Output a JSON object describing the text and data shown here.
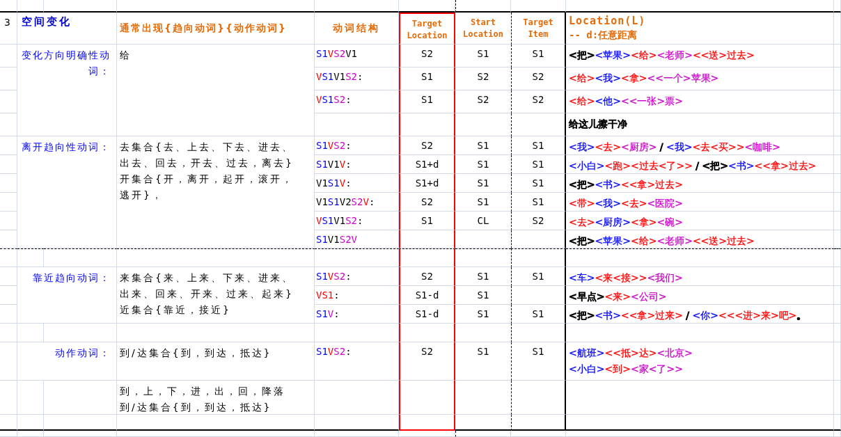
{
  "section": {
    "number": "3",
    "title": "空间变化"
  },
  "headers": {
    "usual": "通常出现{趋向动词}{动作动词}",
    "structure": "动词结构",
    "target_location": [
      "Target",
      "Location"
    ],
    "start_location": [
      "Start",
      "Location"
    ],
    "target_item": [
      "Target",
      "Item"
    ],
    "location": "Location(L)",
    "location_note": "-- d:任意距离"
  },
  "rows": [
    {
      "category": "变化方向明确性动词：",
      "verbs": [
        "给"
      ],
      "structure": [
        {
          "text": "S1",
          "color": "#0000ff"
        },
        {
          "text": "V",
          "color": "#ff0000"
        },
        {
          "text": "S2",
          "color": "#cc00cc"
        },
        {
          "text": "V1",
          "color": "#000000"
        }
      ],
      "target_location": "S2",
      "start_location": "S1",
      "target_item": "S1",
      "example": [
        [
          {
            "text": "<把>",
            "color": "#000000"
          },
          {
            "text": "<苹果>",
            "color": "#0000ff"
          },
          {
            "text": "<给>",
            "color": "#ff0000"
          },
          {
            "text": "<老师>",
            "color": "#cc00cc"
          },
          {
            "text": "<<送>过去>",
            "color": "#ff0000"
          }
        ]
      ]
    },
    {
      "structure": [
        {
          "text": "V",
          "color": "#ff0000"
        },
        {
          "text": "S1",
          "color": "#0000ff"
        },
        {
          "text": "V1",
          "color": "#000000"
        },
        {
          "text": "S2",
          "color": "#cc00cc"
        },
        {
          "text": ":",
          "color": "#000000"
        }
      ],
      "target_location": "S1",
      "start_location": "S2",
      "target_item": "S2",
      "example": [
        [
          {
            "text": "<给>",
            "color": "#ff0000"
          },
          {
            "text": "<我>",
            "color": "#0000ff"
          },
          {
            "text": "<拿>",
            "color": "#ff0000"
          },
          {
            "text": "<<一个>苹果>",
            "color": "#cc00cc"
          }
        ]
      ]
    },
    {
      "structure": [
        {
          "text": "V",
          "color": "#ff0000"
        },
        {
          "text": "S1",
          "color": "#0000ff"
        },
        {
          "text": "S2",
          "color": "#cc00cc"
        },
        {
          "text": ":",
          "color": "#000000"
        }
      ],
      "target_location": "S1",
      "start_location": "S2",
      "target_item": "S2",
      "example": [
        [
          {
            "text": "<给>",
            "color": "#ff0000"
          },
          {
            "text": "<他>",
            "color": "#0000ff"
          },
          {
            "text": "<<一张>票>",
            "color": "#cc00cc"
          }
        ]
      ]
    },
    {
      "example": [
        [
          {
            "text": "给这儿擦干净",
            "color": "#000000"
          }
        ]
      ]
    },
    {
      "category": "离开趋向性动词：",
      "verbs": [
        "去集合{去、上去、下去、进去、出去、回去，开去、过去，离去}",
        "开集合{开，离开，起开，滚开，逃开}，"
      ],
      "structure": [
        {
          "text": "S1",
          "color": "#0000ff"
        },
        {
          "text": "V",
          "color": "#ff0000"
        },
        {
          "text": "S2",
          "color": "#cc00cc"
        },
        {
          "text": ":",
          "color": "#000000"
        }
      ],
      "target_location": "S2",
      "start_location": "S1",
      "target_item": "S1",
      "example": [
        [
          {
            "text": "<我>",
            "color": "#0000ff"
          },
          {
            "text": "<去>",
            "color": "#ff0000"
          },
          {
            "text": "<厨房>",
            "color": "#cc00cc"
          },
          {
            "text": " / ",
            "color": "#000000"
          },
          {
            "text": "<我>",
            "color": "#0000ff"
          },
          {
            "text": "<去<买>>",
            "color": "#ff0000"
          },
          {
            "text": "<咖啡>",
            "color": "#cc00cc"
          }
        ]
      ]
    },
    {
      "structure": [
        {
          "text": "S1",
          "color": "#0000ff"
        },
        {
          "text": "V1",
          "color": "#000000"
        },
        {
          "text": "V",
          "color": "#ff0000"
        },
        {
          "text": ":",
          "color": "#000000"
        }
      ],
      "target_location": "S1+d",
      "start_location": "S1",
      "target_item": "S1",
      "example": [
        [
          {
            "text": "<小白>",
            "color": "#0000ff"
          },
          {
            "text": "<跑>",
            "color": "#ff0000"
          },
          {
            "text": "<过去<了>>",
            "color": "#ff0000"
          },
          {
            "text": " / ",
            "color": "#000000"
          },
          {
            "text": "<把>",
            "color": "#000000"
          },
          {
            "text": "<书>",
            "color": "#0000ff"
          },
          {
            "text": "<<拿>过去>",
            "color": "#ff0000"
          }
        ]
      ]
    },
    {
      "structure": [
        {
          "text": "V1",
          "color": "#000000"
        },
        {
          "text": "S1",
          "color": "#0000ff"
        },
        {
          "text": "V",
          "color": "#ff0000"
        },
        {
          "text": ":",
          "color": "#000000"
        }
      ],
      "target_location": "S1+d",
      "start_location": "S1",
      "target_item": "S1",
      "example": [
        [
          {
            "text": "<把>",
            "color": "#000000"
          },
          {
            "text": "<书>",
            "color": "#0000ff"
          },
          {
            "text": "<<拿>过去>",
            "color": "#ff0000"
          }
        ]
      ]
    },
    {
      "structure": [
        {
          "text": "V1",
          "color": "#000000"
        },
        {
          "text": "S1",
          "color": "#0000ff"
        },
        {
          "text": "V2",
          "color": "#000000"
        },
        {
          "text": "S2",
          "color": "#cc00cc"
        },
        {
          "text": "V",
          "color": "#ff0000"
        },
        {
          "text": ":",
          "color": "#000000"
        }
      ],
      "target_location": "S2",
      "start_location": "S1",
      "target_item": "S1",
      "example": [
        [
          {
            "text": "<带>",
            "color": "#ff0000"
          },
          {
            "text": "<我>",
            "color": "#0000ff"
          },
          {
            "text": "<去>",
            "color": "#ff0000"
          },
          {
            "text": "<医院>",
            "color": "#cc00cc"
          }
        ]
      ]
    },
    {
      "structure": [
        {
          "text": "V",
          "color": "#ff0000"
        },
        {
          "text": "S1",
          "color": "#0000ff"
        },
        {
          "text": "V1",
          "color": "#000000"
        },
        {
          "text": "S2",
          "color": "#cc00cc"
        },
        {
          "text": ":",
          "color": "#000000"
        }
      ],
      "target_location": "S1",
      "start_location": "CL",
      "target_item": "S2",
      "example": [
        [
          {
            "text": "<去>",
            "color": "#ff0000"
          },
          {
            "text": "<厨房>",
            "color": "#0000ff"
          },
          {
            "text": "<拿>",
            "color": "#ff0000"
          },
          {
            "text": "<碗>",
            "color": "#cc00cc"
          }
        ]
      ]
    },
    {
      "structure": [
        {
          "text": "S1",
          "color": "#0000ff"
        },
        {
          "text": "V1",
          "color": "#000000"
        },
        {
          "text": "S2V",
          "color": "#cc00cc"
        }
      ],
      "example": [
        [
          {
            "text": "<把>",
            "color": "#000000"
          },
          {
            "text": "<苹果>",
            "color": "#0000ff"
          },
          {
            "text": "<给>",
            "color": "#ff0000"
          },
          {
            "text": "<老师>",
            "color": "#cc00cc"
          },
          {
            "text": "<<送>过去>",
            "color": "#ff0000"
          }
        ]
      ]
    },
    {},
    {
      "category": "靠近趋向动词：",
      "verbs": [
        "来集合{来、上来、下来、进来、出来、回来、开来、过来、起来}",
        "近集合{靠近，接近}"
      ],
      "structure": [
        {
          "text": "S1",
          "color": "#0000ff"
        },
        {
          "text": "V",
          "color": "#ff0000"
        },
        {
          "text": "S2",
          "color": "#cc00cc"
        },
        {
          "text": ":",
          "color": "#000000"
        }
      ],
      "target_location": "S2",
      "start_location": "S1",
      "target_item": "S1",
      "example": [
        [
          {
            "text": "<车>",
            "color": "#0000ff"
          },
          {
            "text": "<来<接>>",
            "color": "#ff0000"
          },
          {
            "text": "<我们>",
            "color": "#cc00cc"
          }
        ]
      ]
    },
    {
      "structure": [
        {
          "text": "VS1",
          "color": "#ff0000"
        },
        {
          "text": ":",
          "color": "#000000"
        }
      ],
      "target_location": "S1-d",
      "start_location": "S1",
      "example": [
        [
          {
            "text": "<早点>",
            "color": "#000000"
          },
          {
            "text": "<来>",
            "color": "#ff0000"
          },
          {
            "text": "<公司>",
            "color": "#cc00cc"
          }
        ]
      ]
    },
    {
      "structure": [
        {
          "text": "S1",
          "color": "#0000ff"
        },
        {
          "text": "V",
          "color": "#cc00cc"
        },
        {
          "text": ":",
          "color": "#000000"
        }
      ],
      "target_location": "S1-d",
      "start_location": "S1",
      "target_item": "S1",
      "example": [
        [
          {
            "text": "<把>",
            "color": "#000000"
          },
          {
            "text": "<书>",
            "color": "#0000ff"
          },
          {
            "text": "<<拿>过来>",
            "color": "#ff0000"
          },
          {
            "text": " / ",
            "color": "#000000"
          },
          {
            "text": "<你>",
            "color": "#0000ff"
          },
          {
            "text": "<<<进>来>吧>",
            "color": "#ff0000"
          },
          {
            "text": "。",
            "color": "#000000"
          }
        ]
      ]
    },
    {},
    {
      "category": "动作动词：",
      "verbs": [
        "到/达集合{到，到达，抵达}"
      ],
      "structure": [
        {
          "text": "S1",
          "color": "#0000ff"
        },
        {
          "text": "V",
          "color": "#ff0000"
        },
        {
          "text": "S2",
          "color": "#cc00cc"
        },
        {
          "text": ":",
          "color": "#000000"
        }
      ],
      "target_location": "S2",
      "start_location": "S1",
      "target_item": "S1",
      "example": [
        [
          {
            "text": "<航班>",
            "color": "#0000ff"
          },
          {
            "text": "<<抵>达>",
            "color": "#ff0000"
          },
          {
            "text": "<北京>",
            "color": "#cc00cc"
          }
        ],
        [
          {
            "text": "<小白>",
            "color": "#0000ff"
          },
          {
            "text": "<到>",
            "color": "#ff0000"
          },
          {
            "text": "<家<了>>",
            "color": "#cc00cc"
          }
        ]
      ]
    },
    {
      "verbs": [
        "到，上，下，进，出，回，降落",
        "到/达集合{到，到达，抵达}"
      ]
    },
    {}
  ]
}
